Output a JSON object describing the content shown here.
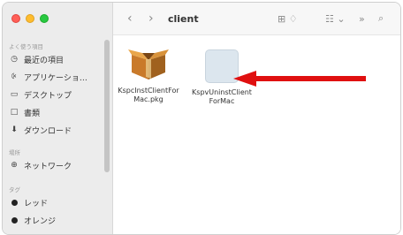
{
  "window": {
    "title": "client",
    "back_glyph": "‹",
    "forward_glyph": "›"
  },
  "sidebar": {
    "favorites_title": "よく使う項目",
    "favorites": [
      {
        "label": "最近の項目",
        "icon": "clock-icon",
        "glyph": "◷"
      },
      {
        "label": "アプリケーショ…",
        "icon": "applications-icon",
        "glyph": "⨴"
      },
      {
        "label": "デスクトップ",
        "icon": "desktop-icon",
        "glyph": "▭"
      },
      {
        "label": "書類",
        "icon": "document-icon",
        "glyph": "□"
      },
      {
        "label": "ダウンロード",
        "icon": "download-icon",
        "glyph": "⬇"
      }
    ],
    "locations_title": "場所",
    "locations": [
      {
        "label": "ネットワーク",
        "icon": "network-icon",
        "glyph": "⊕"
      }
    ],
    "tags_title": "タグ",
    "tags": [
      {
        "label": "レッド",
        "icon": "tag-dot-icon"
      },
      {
        "label": "オレンジ",
        "icon": "tag-dot-icon"
      }
    ]
  },
  "toolbar": {
    "view_glyph": "⊞ ♢",
    "group_glyph": "☷ ⌄",
    "more_glyph": "»",
    "search_glyph": "⌕"
  },
  "files": [
    {
      "name_line1": "KspcInstClientFor",
      "name_line2": "Mac.pkg",
      "icon": "package-icon"
    },
    {
      "name_line1": "KspvUninstClient",
      "name_line2": "ForMac",
      "icon": "app-icon-placeholder"
    }
  ],
  "annotation": {
    "arrow_color": "#e01010"
  }
}
